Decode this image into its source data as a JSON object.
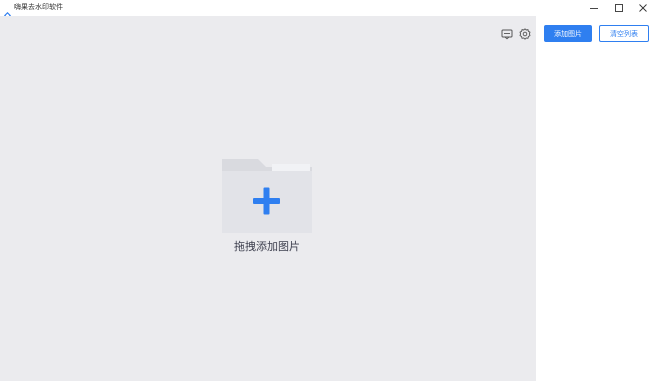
{
  "window": {
    "title": "嗨果去水印软件",
    "controls": {
      "minimize": "minimize",
      "maximize": "maximize",
      "close": "close"
    }
  },
  "drop_area": {
    "label": "拖拽添加图片",
    "icons": [
      "feedback-icon",
      "settings-icon",
      "folder-add-icon"
    ]
  },
  "side_panel": {
    "add_button": "添加图片",
    "clear_button": "清空列表"
  },
  "colors": {
    "accent": "#2f7ff0",
    "drop_background": "#ebebee",
    "folder_body": "#e2e3e8",
    "folder_back": "#d9dadf"
  }
}
